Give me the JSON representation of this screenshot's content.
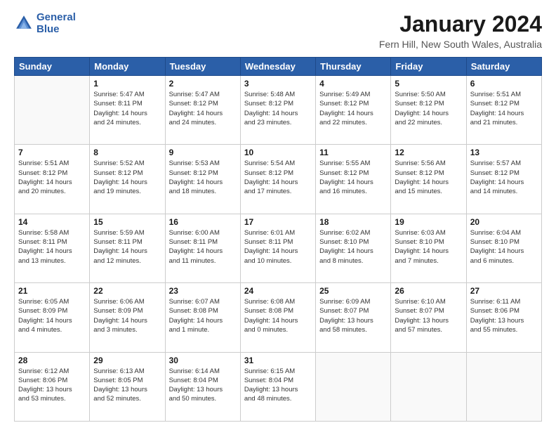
{
  "logo": {
    "line1": "General",
    "line2": "Blue"
  },
  "title": "January 2024",
  "subtitle": "Fern Hill, New South Wales, Australia",
  "days_header": [
    "Sunday",
    "Monday",
    "Tuesday",
    "Wednesday",
    "Thursday",
    "Friday",
    "Saturday"
  ],
  "weeks": [
    [
      {
        "num": "",
        "info": ""
      },
      {
        "num": "1",
        "info": "Sunrise: 5:47 AM\nSunset: 8:11 PM\nDaylight: 14 hours\nand 24 minutes."
      },
      {
        "num": "2",
        "info": "Sunrise: 5:47 AM\nSunset: 8:12 PM\nDaylight: 14 hours\nand 24 minutes."
      },
      {
        "num": "3",
        "info": "Sunrise: 5:48 AM\nSunset: 8:12 PM\nDaylight: 14 hours\nand 23 minutes."
      },
      {
        "num": "4",
        "info": "Sunrise: 5:49 AM\nSunset: 8:12 PM\nDaylight: 14 hours\nand 22 minutes."
      },
      {
        "num": "5",
        "info": "Sunrise: 5:50 AM\nSunset: 8:12 PM\nDaylight: 14 hours\nand 22 minutes."
      },
      {
        "num": "6",
        "info": "Sunrise: 5:51 AM\nSunset: 8:12 PM\nDaylight: 14 hours\nand 21 minutes."
      }
    ],
    [
      {
        "num": "7",
        "info": "Sunrise: 5:51 AM\nSunset: 8:12 PM\nDaylight: 14 hours\nand 20 minutes."
      },
      {
        "num": "8",
        "info": "Sunrise: 5:52 AM\nSunset: 8:12 PM\nDaylight: 14 hours\nand 19 minutes."
      },
      {
        "num": "9",
        "info": "Sunrise: 5:53 AM\nSunset: 8:12 PM\nDaylight: 14 hours\nand 18 minutes."
      },
      {
        "num": "10",
        "info": "Sunrise: 5:54 AM\nSunset: 8:12 PM\nDaylight: 14 hours\nand 17 minutes."
      },
      {
        "num": "11",
        "info": "Sunrise: 5:55 AM\nSunset: 8:12 PM\nDaylight: 14 hours\nand 16 minutes."
      },
      {
        "num": "12",
        "info": "Sunrise: 5:56 AM\nSunset: 8:12 PM\nDaylight: 14 hours\nand 15 minutes."
      },
      {
        "num": "13",
        "info": "Sunrise: 5:57 AM\nSunset: 8:12 PM\nDaylight: 14 hours\nand 14 minutes."
      }
    ],
    [
      {
        "num": "14",
        "info": "Sunrise: 5:58 AM\nSunset: 8:11 PM\nDaylight: 14 hours\nand 13 minutes."
      },
      {
        "num": "15",
        "info": "Sunrise: 5:59 AM\nSunset: 8:11 PM\nDaylight: 14 hours\nand 12 minutes."
      },
      {
        "num": "16",
        "info": "Sunrise: 6:00 AM\nSunset: 8:11 PM\nDaylight: 14 hours\nand 11 minutes."
      },
      {
        "num": "17",
        "info": "Sunrise: 6:01 AM\nSunset: 8:11 PM\nDaylight: 14 hours\nand 10 minutes."
      },
      {
        "num": "18",
        "info": "Sunrise: 6:02 AM\nSunset: 8:10 PM\nDaylight: 14 hours\nand 8 minutes."
      },
      {
        "num": "19",
        "info": "Sunrise: 6:03 AM\nSunset: 8:10 PM\nDaylight: 14 hours\nand 7 minutes."
      },
      {
        "num": "20",
        "info": "Sunrise: 6:04 AM\nSunset: 8:10 PM\nDaylight: 14 hours\nand 6 minutes."
      }
    ],
    [
      {
        "num": "21",
        "info": "Sunrise: 6:05 AM\nSunset: 8:09 PM\nDaylight: 14 hours\nand 4 minutes."
      },
      {
        "num": "22",
        "info": "Sunrise: 6:06 AM\nSunset: 8:09 PM\nDaylight: 14 hours\nand 3 minutes."
      },
      {
        "num": "23",
        "info": "Sunrise: 6:07 AM\nSunset: 8:08 PM\nDaylight: 14 hours\nand 1 minute."
      },
      {
        "num": "24",
        "info": "Sunrise: 6:08 AM\nSunset: 8:08 PM\nDaylight: 14 hours\nand 0 minutes."
      },
      {
        "num": "25",
        "info": "Sunrise: 6:09 AM\nSunset: 8:07 PM\nDaylight: 13 hours\nand 58 minutes."
      },
      {
        "num": "26",
        "info": "Sunrise: 6:10 AM\nSunset: 8:07 PM\nDaylight: 13 hours\nand 57 minutes."
      },
      {
        "num": "27",
        "info": "Sunrise: 6:11 AM\nSunset: 8:06 PM\nDaylight: 13 hours\nand 55 minutes."
      }
    ],
    [
      {
        "num": "28",
        "info": "Sunrise: 6:12 AM\nSunset: 8:06 PM\nDaylight: 13 hours\nand 53 minutes."
      },
      {
        "num": "29",
        "info": "Sunrise: 6:13 AM\nSunset: 8:05 PM\nDaylight: 13 hours\nand 52 minutes."
      },
      {
        "num": "30",
        "info": "Sunrise: 6:14 AM\nSunset: 8:04 PM\nDaylight: 13 hours\nand 50 minutes."
      },
      {
        "num": "31",
        "info": "Sunrise: 6:15 AM\nSunset: 8:04 PM\nDaylight: 13 hours\nand 48 minutes."
      },
      {
        "num": "",
        "info": ""
      },
      {
        "num": "",
        "info": ""
      },
      {
        "num": "",
        "info": ""
      }
    ]
  ]
}
